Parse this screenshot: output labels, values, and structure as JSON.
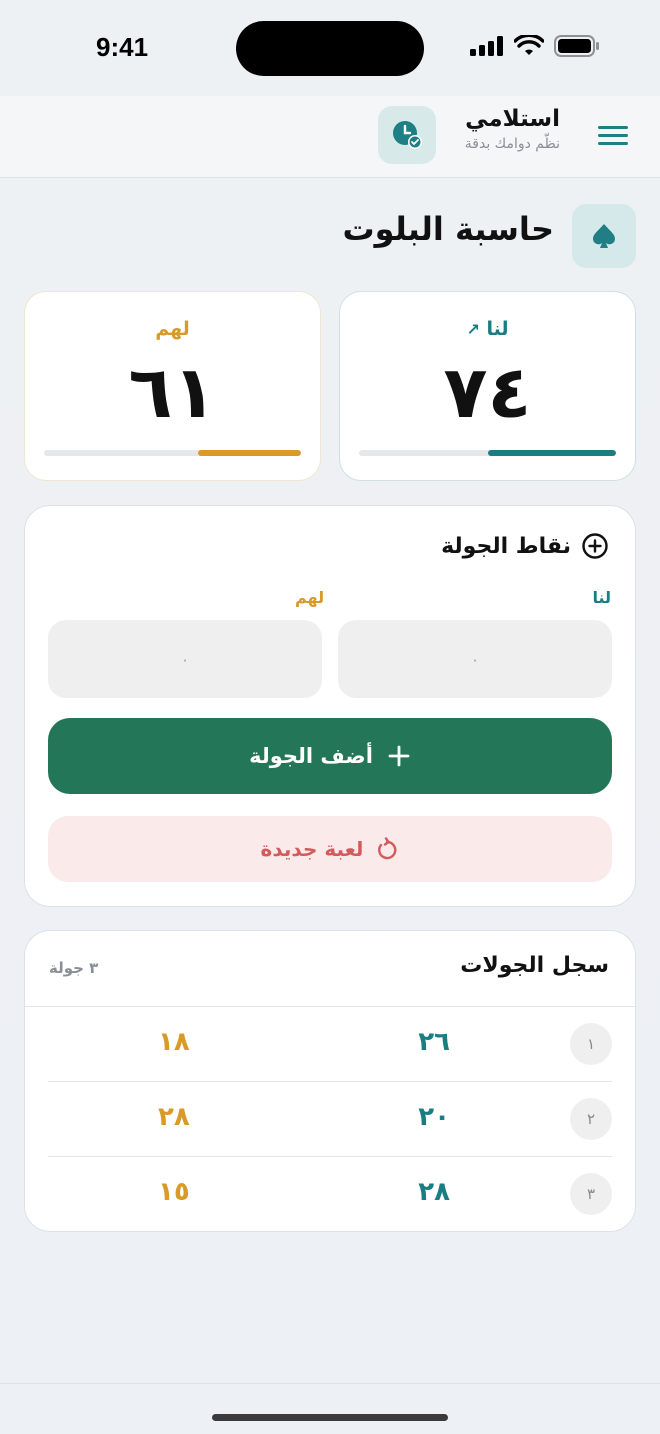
{
  "status_bar": {
    "time": "9:41"
  },
  "header": {
    "app_name": "استلامي",
    "tagline": "نظّم دوامك بدقة"
  },
  "page": {
    "title": "حاسبة البلوت"
  },
  "scores": {
    "us": {
      "label": "لنا",
      "value": "٧٤",
      "progress_fraction": 0.5
    },
    "them": {
      "label": "لهم",
      "value": "٦١",
      "progress_fraction": 0.4
    }
  },
  "round_points": {
    "title": "نقاط الجولة",
    "us_label": "لنا",
    "them_label": "لهم",
    "us_placeholder": "٠",
    "them_placeholder": "٠",
    "add_button": "أضف الجولة",
    "new_game_button": "لعبة جديدة"
  },
  "history": {
    "title": "سجل الجولات",
    "count": "٣ جولة",
    "rows": [
      {
        "num": "١",
        "us": "٢٦",
        "them": "١٨"
      },
      {
        "num": "٢",
        "us": "٢٠",
        "them": "٢٨"
      },
      {
        "num": "٣",
        "us": "٢٨",
        "them": "١٥"
      }
    ]
  },
  "colors": {
    "teal": "#197d82",
    "gold": "#d89b28",
    "green_button": "#237657",
    "danger": "#d45b5b"
  }
}
